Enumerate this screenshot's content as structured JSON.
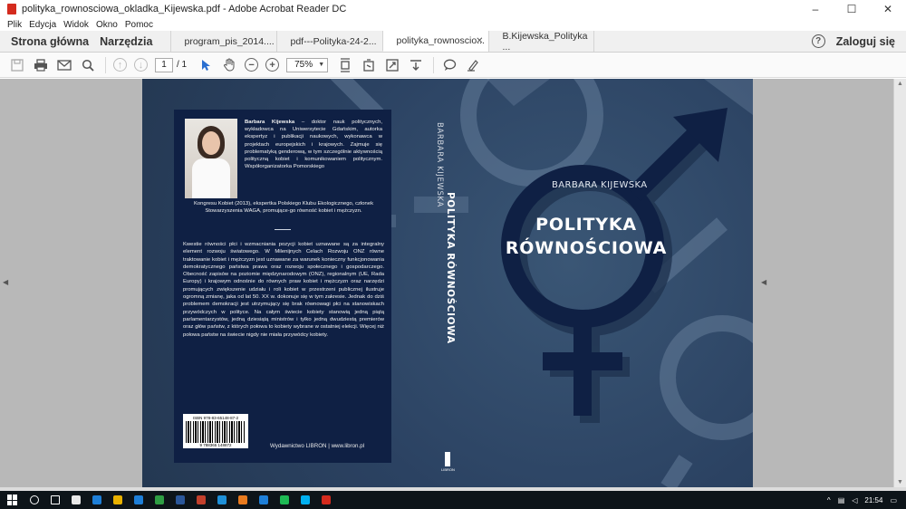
{
  "window": {
    "title": "polityka_rownosciowa_okladka_Kijewska.pdf - Adobe Acrobat Reader DC",
    "controls": {
      "minimize": "–",
      "maximize": "☐",
      "close": "✕"
    }
  },
  "menu": [
    "Plik",
    "Edycja",
    "Widok",
    "Okno",
    "Pomoc"
  ],
  "tabs": {
    "home": "Strona główna",
    "tools": "Narzędzia",
    "documents": [
      {
        "label": "program_pis_2014....",
        "active": false
      },
      {
        "label": "pdf---Polityka-24-2...",
        "active": false
      },
      {
        "label": "polityka_rownoscio...",
        "active": true,
        "close": "✕"
      },
      {
        "label": "B.Kijewska_Polityka ...",
        "active": false
      }
    ],
    "help": "?",
    "login": "Zaloguj się"
  },
  "toolbar": {
    "page_current": "1",
    "page_total": "/ 1",
    "zoom": "75%"
  },
  "cover": {
    "back": {
      "bio_name": "Barbara Kijewska",
      "bio_text": " – doktor nauk politycznych, wykładowca na Uniwersytecie Gdańskim, autorka ekspertyz i publikacji naukowych, wykonawca w projektach europejskich i krajowych. Zajmuje się problematyką genderową, w tym szczególnie aktywnością polityczną kobiet i komunikowaniem politycznym. Współorganizatorka Pomorskiego",
      "bio_tail": "Kongresu Kobiet (2013), ekspertka Polskiego Klubu Ekologicznego, członek Stowarzyszenia WAGA, promujące-go równość kobiet i mężczyzn.",
      "blurb": "Kwestie równości płci i wzmacniania pozycji kobiet uznawane są za integralny element rozwoju światowego. W Milenijnych Celach Rozwoju ONZ równe traktowanie kobiet i mężczyzn jest uznawane za warunek konieczny funkcjonowania demokratycznego państwa prawa oraz rozwoju społecznego i gospodarczego. Obecność zapisów na poziomie międzynarodowym (ONZ), regionalnym (UE, Rada Europy) i krajowym odnośnie do równych praw kobiet i mężczyzn oraz narzędzi promujących zwiększenie udziału i roli kobiet w przestrzeni publicznej ilustruje ogromną zmianę, jaka od lat 50. XX w. dokonuje się w tym zakresie. Jednak do dziś problemem demokracji jest utrzymujący się brak równowagi płci na stanowiskach przywódczych w polityce. Na całym świecie kobiety stanowią jedną piątą parlamentarzystów, jedną dziesiątą ministrów i tylko jedną dwudziestą premierów oraz głów państw, z których połowa to kobiety wybrane w ostatniej elekcji. Więcej niż połowa państw na świecie nigdy nie miała przywódcy kobiety.",
      "isbn": "ISBN 978-83-65148-87-2",
      "barcode_digits": "9 788365 148872",
      "publisher": "Wydawnictwo LIBRON    |    www.libron.pl"
    },
    "spine": {
      "author": "BARBARA KIJEWSKA",
      "title": "POLITYKA RÓWNOŚCIOWA",
      "logo": "LIBRON"
    },
    "front": {
      "author": "BARBARA KIJEWSKA",
      "title_line1": "POLITYKA",
      "title_line2": "RÓWNOŚCIOWA"
    }
  },
  "taskbar": {
    "time": "21:54",
    "app_colors": [
      "#e8e8e8",
      "#1e7fd8",
      "#e8b100",
      "#1e7fd8",
      "#2f9e44",
      "#2b579a",
      "#c3402c",
      "#1e90d8",
      "#e87a1e",
      "#1e7fd8",
      "#1db954",
      "#00aff0",
      "#d42b1e"
    ]
  },
  "colors": {
    "cover_bg": "#2b4262",
    "panel": "#0f2044",
    "symbol_light": "#6f87a3",
    "symbol_dark": "#0f2044"
  }
}
